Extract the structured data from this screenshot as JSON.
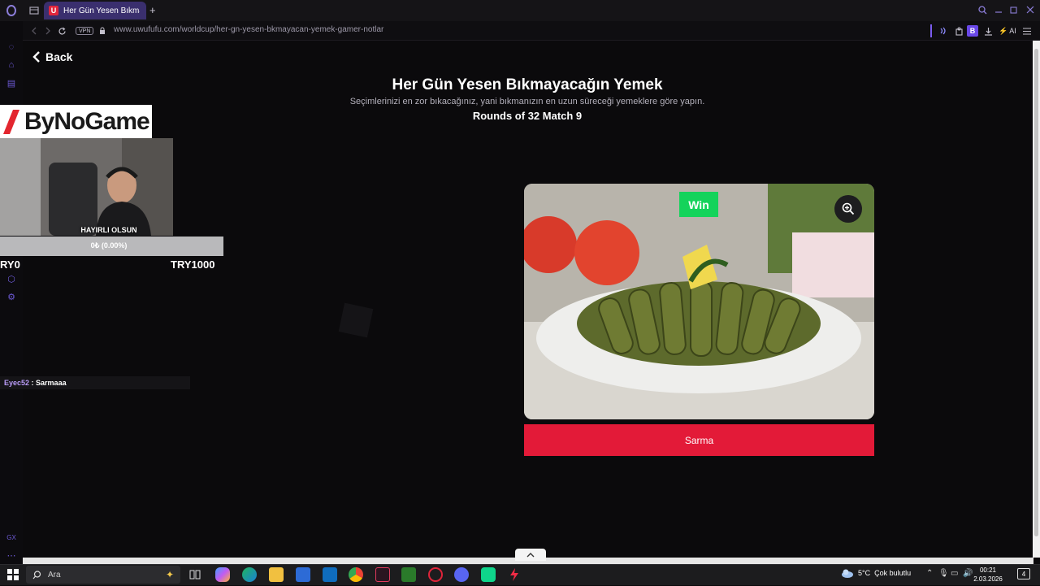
{
  "browser": {
    "tab_title": "Her Gün Yesen Bıkmayacağın",
    "favicon_letter": "U",
    "url": "www.uwufufu.com/worldcup/her-gn-yesen-bkmayacan-yemek-gamer-notlar",
    "vpn_label": "VPN",
    "new_tab_symbol": "+",
    "profile_letter": "B",
    "ai_label": "AI"
  },
  "page": {
    "back_label": "Back",
    "title": "Her Gün Yesen Bıkmayacağın Yemek",
    "subtitle": "Seçimlerinizi en zor bıkacağınız, yani bıkmanızın en uzun süreceği yemeklere göre yapın.",
    "rounds": "Rounds of 32 Match 9"
  },
  "card": {
    "win_label": "Win",
    "name": "Sarma"
  },
  "stream_overlay": {
    "logo": "ByNoGame",
    "donation_label": "HAYIRLI OLSUN",
    "progress_text": "0₺ (0.00%)",
    "progress_fraction": 0,
    "goal_left": "RY0",
    "goal_right": "TRY1000",
    "chat_user": "Eyec52",
    "chat_message": ": Sarmaaa"
  },
  "taskbar": {
    "search_placeholder": "Ara",
    "weather_temp": "5°C",
    "weather_text": "Çok bulutlu",
    "time": "00:21",
    "date": "2.03.2026",
    "notification_count": "4"
  },
  "colors": {
    "accent": "#e31a38",
    "win": "#14d35b",
    "tab": "#3a2f6e",
    "sidebar_icon": "#6d5ad6"
  }
}
